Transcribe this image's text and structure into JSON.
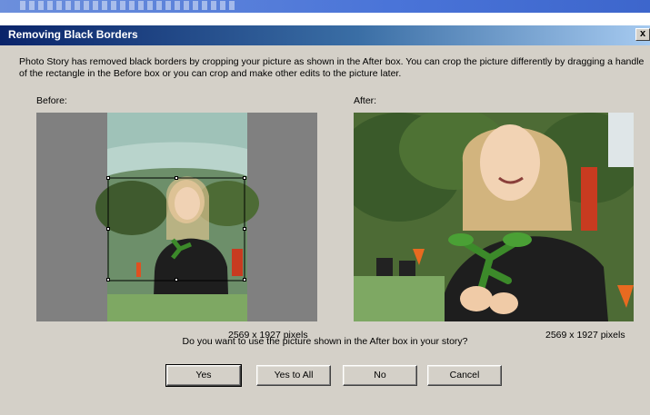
{
  "dialog": {
    "title": "Removing Black Borders",
    "close_label": "x",
    "description": "Photo Story has removed black borders by cropping your picture as shown in the After box. You can crop the picture differently by dragging a handle of the rectangle in the Before box or you can crop and make other edits to the picture later.",
    "before_label": "Before:",
    "after_label": "After:",
    "before_size": "2569 x 1927 pixels",
    "after_size": "2569 x 1927 pixels",
    "question": "Do you want to use the picture shown in the After box in your story?",
    "buttons": {
      "yes": "Yes",
      "yes_to_all": "Yes to All",
      "no": "No",
      "cancel": "Cancel"
    }
  },
  "colors": {
    "dialog_bg": "#d4d0c8",
    "titlebar_start": "#0a246a",
    "titlebar_end": "#a6caf0",
    "before_border_gray": "#808080"
  }
}
